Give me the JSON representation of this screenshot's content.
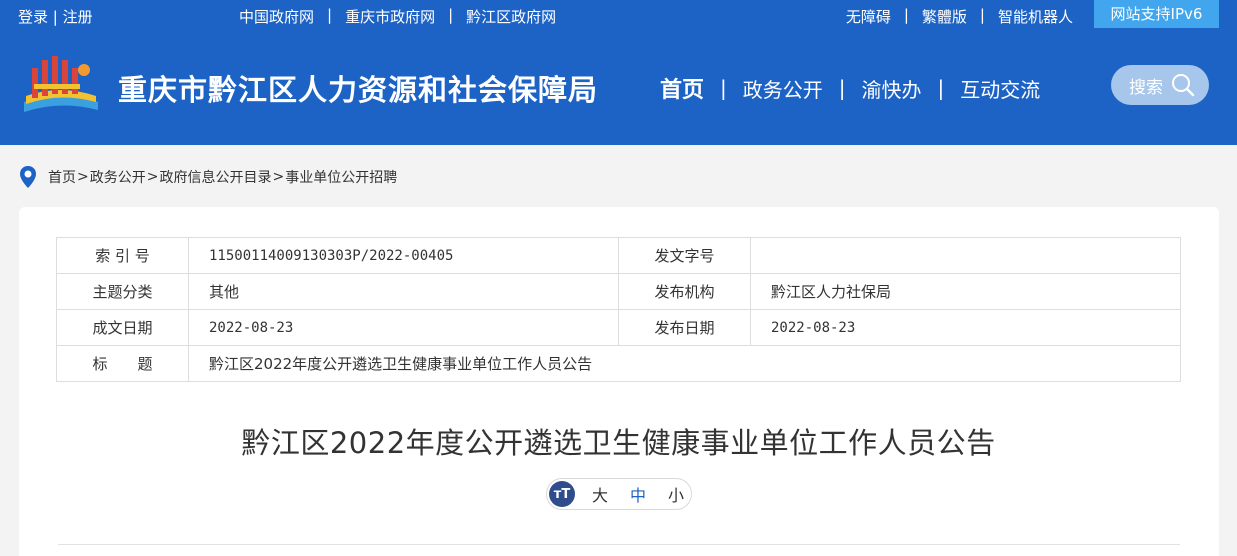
{
  "topbar": {
    "login": "登录",
    "register": "注册",
    "gov_links": [
      "中国政府网",
      "重庆市政府网",
      "黔江区政府网"
    ],
    "right_links": [
      "无障碍",
      "繁體版",
      "智能机器人"
    ],
    "ipv6": "网站支持IPv6"
  },
  "site": {
    "title": "重庆市黔江区人力资源和社会保障局"
  },
  "nav": {
    "items": [
      "首页",
      "政务公开",
      "渝快办",
      "互动交流"
    ]
  },
  "search": {
    "label": "搜索"
  },
  "breadcrumb": [
    "首页",
    "政务公开",
    "政府信息公开目录",
    "事业单位公开招聘"
  ],
  "meta": {
    "index_label": "索 引 号",
    "index_value": "11500114009130303P/2022-00405",
    "docno_label": "发文字号",
    "docno_value": "",
    "topic_label": "主题分类",
    "topic_value": "其他",
    "org_label": "发布机构",
    "org_value": "黔江区人力社保局",
    "date_label": "成文日期",
    "date_value": "2022-08-23",
    "pub_label": "发布日期",
    "pub_value": "2022-08-23",
    "title_label": "标　　题",
    "title_value": "黔江区2022年度公开遴选卫生健康事业单位工作人员公告"
  },
  "article": {
    "title": "黔江区2022年度公开遴选卫生健康事业单位工作人员公告"
  },
  "fontsize": {
    "icon": "тT",
    "large": "大",
    "medium": "中",
    "small": "小"
  },
  "colors": {
    "brand_blue": "#1d63c6",
    "ipv6_bg": "#41a6ee",
    "search_bg": "#a6c6ec"
  }
}
